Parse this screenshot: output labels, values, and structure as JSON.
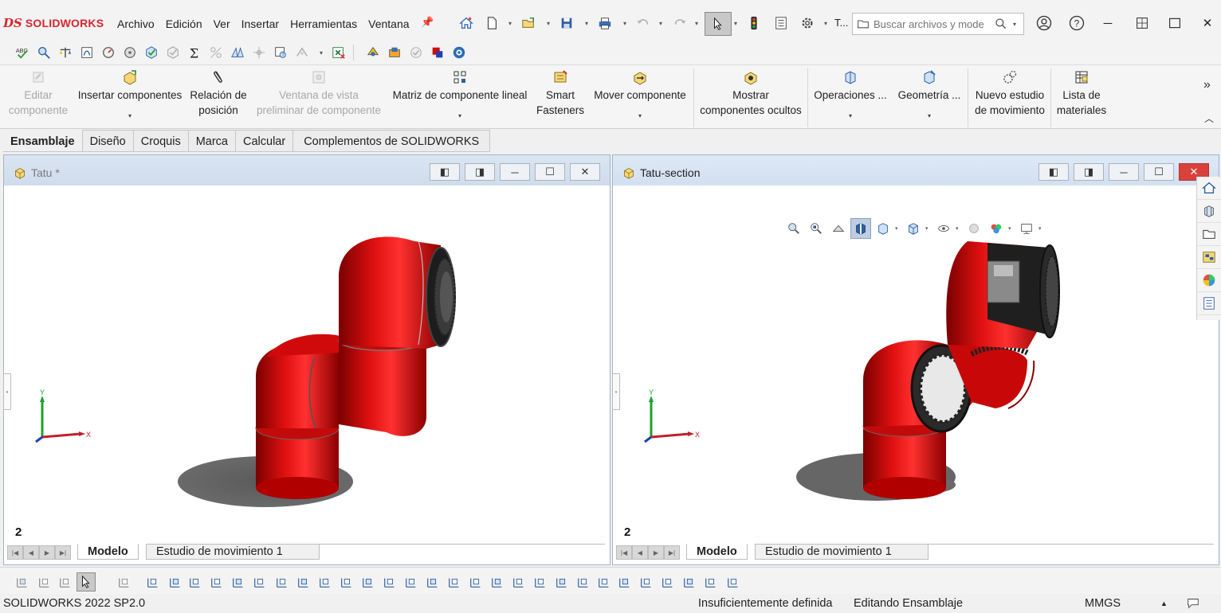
{
  "app": {
    "logo_ds": "DS",
    "logo_name": "SOLIDWORKS"
  },
  "menu": [
    "Archivo",
    "Edición",
    "Ver",
    "Insertar",
    "Herramientas",
    "Ventana"
  ],
  "titlebar": {
    "truncated_label": "T...",
    "search_placeholder": "Buscar archivos y mode"
  },
  "command_manager": [
    {
      "label": "Editar\ncomponente",
      "disabled": true
    },
    {
      "label": "Insertar componentes",
      "has_dropdown": true
    },
    {
      "label": "Relación de\nposición"
    },
    {
      "label": "Ventana de vista\npreliminar de componente",
      "disabled": true
    },
    {
      "label": "Matriz de componente lineal",
      "has_dropdown": true
    },
    {
      "label": "Smart\nFasteners"
    },
    {
      "label": "Mover componente",
      "has_dropdown": true
    },
    {
      "label": "Mostrar\ncomponentes ocultos"
    },
    {
      "label": "Operaciones ...",
      "has_dropdown": true
    },
    {
      "label": "Geometría ...",
      "has_dropdown": true
    },
    {
      "label": "Nuevo estudio\nde movimiento"
    },
    {
      "label": "Lista de\nmateriales"
    }
  ],
  "tabs": [
    "Ensamblaje",
    "Diseño",
    "Croquis",
    "Marca",
    "Calcular",
    "Complementos de SOLIDWORKS"
  ],
  "viewports": [
    {
      "title": "Tatu *",
      "sheet_number": "2",
      "model_tab": "Modelo",
      "motion_tab": "Estudio de movimiento 1",
      "axis_x": "X",
      "axis_y": "Y",
      "active": false
    },
    {
      "title": "Tatu-section",
      "sheet_number": "2",
      "model_tab": "Modelo",
      "motion_tab": "Estudio de movimiento 1",
      "axis_x": "X",
      "axis_y": "Y",
      "active": true
    }
  ],
  "status": {
    "version": "SOLIDWORKS 2022 SP2.0",
    "definition": "Insuficientemente definida",
    "mode": "Editando Ensamblaje",
    "units": "MMGS"
  },
  "colors": {
    "part_red": "#d20a0a",
    "accent_blue": "#2d6db5",
    "brand_red": "#d7262f"
  }
}
